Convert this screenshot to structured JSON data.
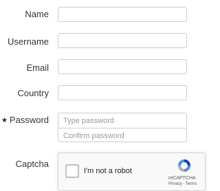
{
  "form": {
    "name_label": "Name",
    "username_label": "Username",
    "email_label": "Email",
    "country_label": "Country",
    "password_label": "Password",
    "password_required_marker": "★",
    "password_placeholder": "Type password",
    "confirm_password_placeholder": "Confirm password",
    "captcha_label": "Captcha"
  },
  "recaptcha": {
    "checkbox_text": "I'm not a robot",
    "brand": "reCAPTCHA",
    "links": "Privacy - Terms",
    "logo_icon": "recaptcha-logo-icon"
  }
}
